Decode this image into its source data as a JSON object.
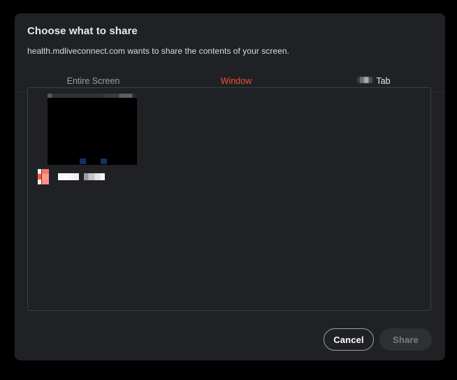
{
  "dialog": {
    "title": "Choose what to share",
    "subtitle": "health.mdliveconnect.com wants to share the contents of your screen.",
    "accent_color": "#ee5035",
    "background_color": "#202124",
    "backdrop_color": "#000000"
  },
  "tabs": [
    {
      "id": "entire-screen",
      "label": "Entire Screen",
      "selected": false
    },
    {
      "id": "window",
      "label": "Window",
      "selected": true
    },
    {
      "id": "tab",
      "label": "Tab",
      "selected": false,
      "redacted_prefix": true
    }
  ],
  "source_list": {
    "items": [
      {
        "title_redacted": true,
        "thumbnail_description": "black application window with light title bar",
        "icon_name": "app-icon-redacted",
        "icon_colors": [
          "#f2f2f2",
          "#ee4a38",
          "#f99184"
        ],
        "selected": false
      }
    ]
  },
  "footer": {
    "cancel_label": "Cancel",
    "share_label": "Share",
    "share_enabled": false
  }
}
